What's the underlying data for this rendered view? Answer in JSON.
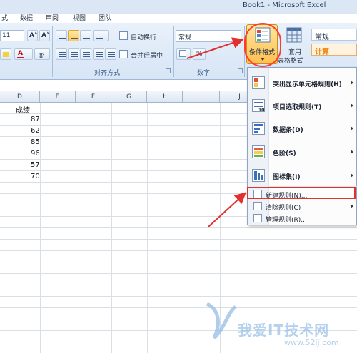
{
  "window": {
    "title": "Book1 - Microsoft Excel"
  },
  "menu_tabs": [
    "式",
    "数据",
    "审阅",
    "视图",
    "团队"
  ],
  "ribbon": {
    "font_size": "11",
    "grow_font": "A˄",
    "shrink_font": "A˅",
    "font_color": "A",
    "phonetic": "变",
    "wrap_text": "自动换行",
    "merge_center": "合并后居中",
    "number_format": "常规",
    "percent": "%",
    "conditional_formatting": "条件格式",
    "table_format_line1": "套用",
    "table_format_line2": "表格格式",
    "style_normal": "常规",
    "style_calc": "计算",
    "groups": {
      "alignment": "对齐方式",
      "number": "数字"
    }
  },
  "columns": [
    "D",
    "E",
    "F",
    "G",
    "H",
    "I",
    "J"
  ],
  "cells": {
    "header": "成绩",
    "scores": [
      "87",
      "62",
      "85",
      "96",
      "57",
      "70"
    ]
  },
  "dropdown": {
    "items": [
      {
        "label": "突出显示单元格规则(H)",
        "has_submenu": true
      },
      {
        "label": "项目选取规则(T)",
        "has_submenu": true
      },
      {
        "label": "数据条(D)",
        "has_submenu": true
      },
      {
        "label": "色阶(S)",
        "has_submenu": true
      },
      {
        "label": "图标集(I)",
        "has_submenu": true
      }
    ],
    "small_items": [
      {
        "label": "新建规则(N)...",
        "has_submenu": false
      },
      {
        "label": "清除规则(C)",
        "has_submenu": true
      },
      {
        "label": "管理规则(R)...",
        "has_submenu": false
      }
    ]
  },
  "colors": {
    "highlight_red": "#e0312e",
    "button_orange": "#ffc95c",
    "ribbon_blue": "#d7e5f6"
  },
  "watermark": {
    "text": "我爱IT技术网",
    "url": "www.52ij.com"
  }
}
